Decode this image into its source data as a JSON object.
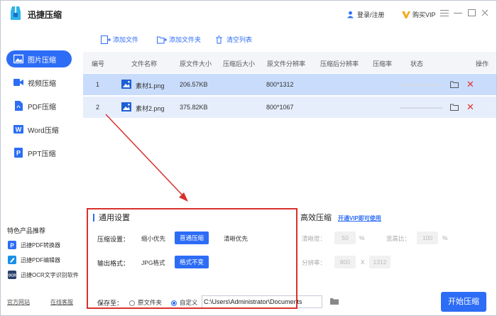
{
  "app": {
    "title": "迅捷压缩"
  },
  "header": {
    "login_label": "登录/注册",
    "buy_vip_label": "购买VIP"
  },
  "sidebar": {
    "items": [
      {
        "label": "图片压缩",
        "active": true
      },
      {
        "label": "视频压缩",
        "active": false
      },
      {
        "label": "PDF压缩",
        "active": false
      },
      {
        "label": "Word压缩",
        "active": false
      },
      {
        "label": "PPT压缩",
        "active": false
      }
    ],
    "featured_title": "特色产品推荐",
    "featured": [
      {
        "label": "迅捷PDF转换器",
        "icon": "pdf-converter-icon"
      },
      {
        "label": "迅捷PDF编辑器",
        "icon": "pdf-editor-icon"
      },
      {
        "label": "迅捷OCR文字识别软件",
        "icon": "ocr-icon"
      }
    ],
    "footer": {
      "website": "官方网站",
      "support": "在线客服"
    }
  },
  "toolbar": {
    "add_file": "添加文件",
    "add_folder": "添加文件夹",
    "clear_list": "清空列表"
  },
  "table": {
    "headers": [
      "编号",
      "文件名称",
      "原文件大小",
      "压缩后大小",
      "原文件分辨率",
      "压缩后分辨率",
      "压缩率",
      "状态",
      "操作"
    ],
    "rows": [
      {
        "num": "1",
        "name": "素材1.png",
        "size": "206.57KB",
        "res": "800*1312"
      },
      {
        "num": "2",
        "name": "素材2.png",
        "size": "375.82KB",
        "res": "800*1067"
      }
    ]
  },
  "settings": {
    "title": "通用设置",
    "compress_label": "压缩设置：",
    "compress_options": [
      "缩小优先",
      "普通压缩",
      "清晰优先"
    ],
    "format_label": "输出格式：",
    "format_options": [
      "JPG格式",
      "格式不变"
    ],
    "save_label": "保存至：",
    "save_options": [
      "原文件夹",
      "自定义"
    ],
    "save_path": "C:\\Users\\Administrator\\Documents"
  },
  "efficient": {
    "title": "高效压缩",
    "vip_link": "开通VIP即可使用",
    "clarity_label": "清晰度：",
    "clarity_value": "50",
    "clarity_unit": "%",
    "ratio_label": "宽高比：",
    "ratio_value": "100",
    "ratio_unit": "%",
    "resolution_label": "分辨率：",
    "res_w": "800",
    "res_sep": "X",
    "res_h": "1312"
  },
  "start_button": "开始压缩",
  "colors": {
    "accent": "#2d6df6",
    "annotation": "#d9312c",
    "delete": "#e5312e"
  }
}
